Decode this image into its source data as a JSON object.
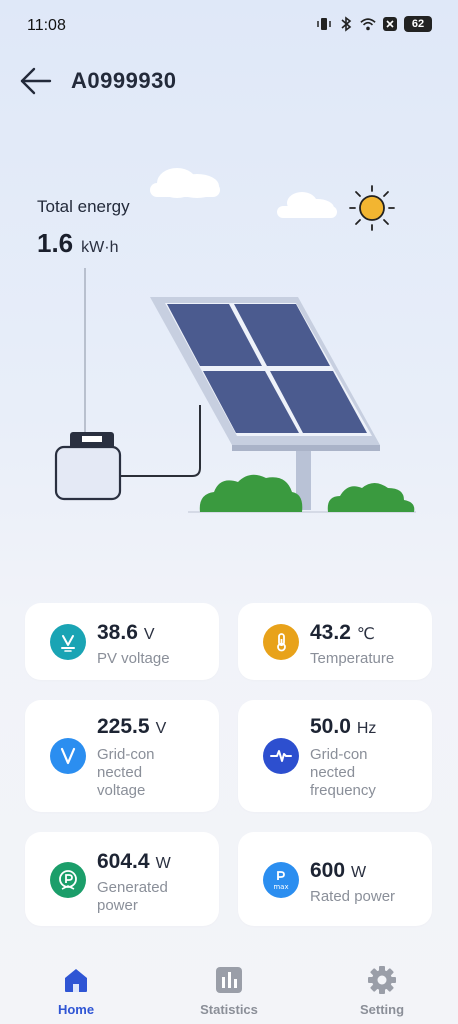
{
  "status_bar": {
    "time": "11:08",
    "battery": "62"
  },
  "header": {
    "title": "A0999930"
  },
  "hero": {
    "energy_label": "Total energy",
    "energy_value": "1.6",
    "energy_unit": "kW·h"
  },
  "metrics": [
    {
      "value": "38.6",
      "unit": "V",
      "label": "PV voltage",
      "icon": "pv-voltage-icon",
      "color": "#1aa4b4"
    },
    {
      "value": "43.2",
      "unit": "℃",
      "label": "Temperature",
      "icon": "thermometer-icon",
      "color": "#e8a21a"
    },
    {
      "value": "225.5",
      "unit": "V",
      "label": "Grid-con nected voltage",
      "icon": "voltage-icon",
      "color": "#2b8ef0"
    },
    {
      "value": "50.0",
      "unit": "Hz",
      "label": "Grid-con nected frequency",
      "icon": "frequency-wave-icon",
      "color": "#2d4fcf"
    },
    {
      "value": "604.4",
      "unit": "W",
      "label": "Generated power",
      "icon": "generated-power-icon",
      "color": "#1b9e6a"
    },
    {
      "value": "600",
      "unit": "W",
      "label": "Rated power",
      "icon": "rated-power-icon",
      "color": "#2b8ef0"
    }
  ],
  "tabs": [
    {
      "label": "Home",
      "icon": "home-icon",
      "active": true
    },
    {
      "label": "Statistics",
      "icon": "bar-chart-icon",
      "active": false
    },
    {
      "label": "Setting",
      "icon": "gear-icon",
      "active": false
    }
  ],
  "colors": {
    "accent": "#2f55d4",
    "panel": "#4b5b8f",
    "bush": "#3a9a3f",
    "sun": "#f2b531"
  }
}
